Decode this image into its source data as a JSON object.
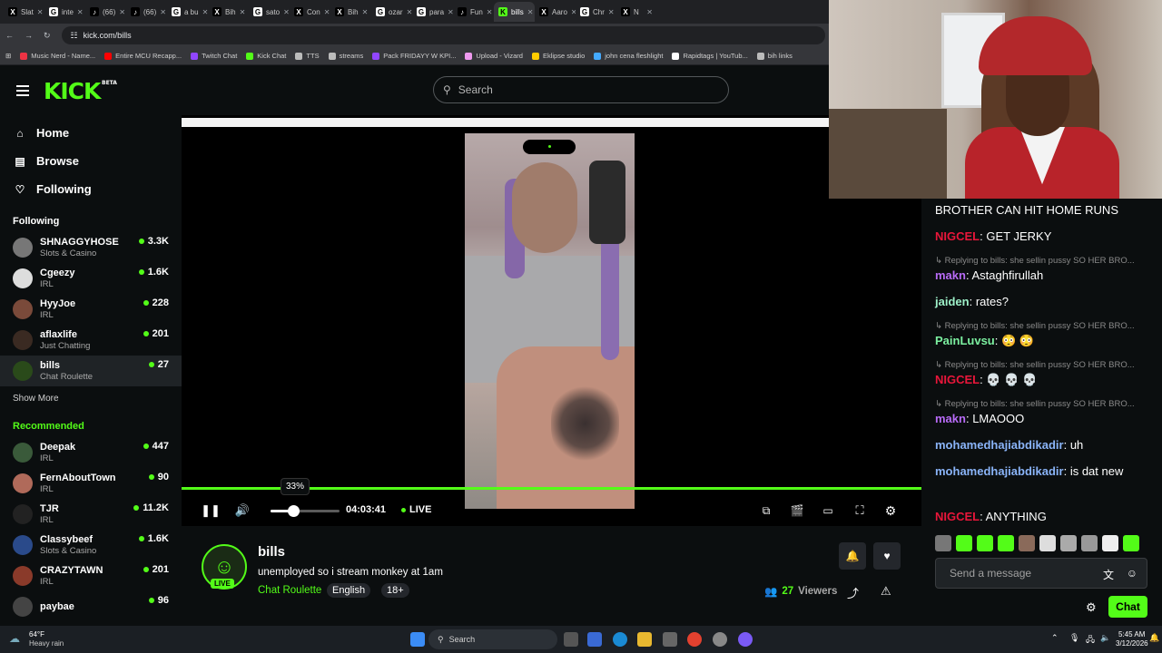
{
  "browser": {
    "tabs": [
      {
        "label": "Slat",
        "fav": "X",
        "color": "#000"
      },
      {
        "label": "inte",
        "fav": "G",
        "color": "#fff"
      },
      {
        "label": "(66)",
        "fav": "♪",
        "color": "#000"
      },
      {
        "label": "(66)",
        "fav": "♪",
        "color": "#000"
      },
      {
        "label": "a bu",
        "fav": "G",
        "color": "#fff"
      },
      {
        "label": "Bih",
        "fav": "X",
        "color": "#000"
      },
      {
        "label": "sato",
        "fav": "G",
        "color": "#fff"
      },
      {
        "label": "Con",
        "fav": "X",
        "color": "#000"
      },
      {
        "label": "Bih",
        "fav": "X",
        "color": "#000"
      },
      {
        "label": "ozar",
        "fav": "G",
        "color": "#fff"
      },
      {
        "label": "para",
        "fav": "G",
        "color": "#fff"
      },
      {
        "label": "Fun",
        "fav": "♪",
        "color": "#000"
      },
      {
        "label": "bills",
        "fav": "K",
        "color": "#53fc18",
        "active": true
      },
      {
        "label": "Aaro",
        "fav": "X",
        "color": "#000"
      },
      {
        "label": "Chr",
        "fav": "G",
        "color": "#fff"
      },
      {
        "label": "N",
        "fav": "X",
        "color": "#000"
      }
    ],
    "url": "kick.com/bills",
    "bookmarks": [
      {
        "label": "Music Nerd - Name...",
        "color": "#e34"
      },
      {
        "label": "Entire MCU Recapp...",
        "color": "#f00"
      },
      {
        "label": "Twitch Chat",
        "color": "#9146ff"
      },
      {
        "label": "Kick Chat",
        "color": "#53fc18"
      },
      {
        "label": "TTS",
        "color": "#bbb"
      },
      {
        "label": "streams",
        "color": "#bbb"
      },
      {
        "label": "Pack FRIDAYY W KPI...",
        "color": "#9146ff"
      },
      {
        "label": "Upload - Vizard",
        "color": "#e9e"
      },
      {
        "label": "Eklipse studio",
        "color": "#fc0"
      },
      {
        "label": "john cena fleshlight",
        "color": "#4af"
      },
      {
        "label": "Rapidtags | YouTub...",
        "color": "#fff"
      },
      {
        "label": "bih links",
        "color": "#bbb"
      }
    ]
  },
  "header": {
    "logo": "KICK",
    "beta": "BETA",
    "search_placeholder": "Search"
  },
  "sidebar": {
    "nav": [
      {
        "label": "Home",
        "icon": "⌂"
      },
      {
        "label": "Browse",
        "icon": "▤"
      },
      {
        "label": "Following",
        "icon": "♡"
      }
    ],
    "following_title": "Following",
    "following": [
      {
        "name": "SHNAGGYHOSE",
        "cat": "Slots & Casino",
        "viewers": "3.3K",
        "color": "#777"
      },
      {
        "name": "Cgeezy",
        "cat": "IRL",
        "viewers": "1.6K",
        "color": "#ddd"
      },
      {
        "name": "HyyJoe",
        "cat": "IRL",
        "viewers": "228",
        "color": "#7a4a3a"
      },
      {
        "name": "aflaxlife",
        "cat": "Just Chatting",
        "viewers": "201",
        "color": "#3a2a22"
      },
      {
        "name": "bills",
        "cat": "Chat Roulette",
        "viewers": "27",
        "color": "#2a4a1a",
        "selected": true
      }
    ],
    "show_more": "Show More",
    "recommended_title": "Recommended",
    "recommended": [
      {
        "name": "Deepak",
        "cat": "IRL",
        "viewers": "447",
        "color": "#3a5a3a"
      },
      {
        "name": "FernAboutTown",
        "cat": "IRL",
        "viewers": "90",
        "color": "#b06a5a"
      },
      {
        "name": "TJR",
        "cat": "IRL",
        "viewers": "11.2K",
        "color": "#222"
      },
      {
        "name": "Classybeef",
        "cat": "Slots & Casino",
        "viewers": "1.6K",
        "color": "#2a4a8a"
      },
      {
        "name": "CRAZYTAWN",
        "cat": "IRL",
        "viewers": "201",
        "color": "#8a3a2a"
      },
      {
        "name": "paybae",
        "cat": "",
        "viewers": "96",
        "color": "#444"
      }
    ]
  },
  "player": {
    "volume_tooltip": "33%",
    "volume_level": 0.33,
    "timecode": "04:03:41",
    "live_label": "LIVE"
  },
  "stream": {
    "name": "bills",
    "live_badge": "LIVE",
    "title": "unemployed so i stream monkey at 1am",
    "category": "Chat Roulette",
    "tags": [
      "English",
      "18+"
    ],
    "viewers_count": "27",
    "viewers_label": "Viewers"
  },
  "chat": {
    "messages": [
      {
        "type": "msg",
        "user": "",
        "color": "#fff",
        "text": "BROTHER CAN HIT HOME RUNS"
      },
      {
        "type": "msg",
        "user": "NIGCEL",
        "color": "#e9163a",
        "text": "GET JERKY"
      },
      {
        "type": "reply",
        "text": "↳ Replying to bills: she sellin pussy SO HER BRO..."
      },
      {
        "type": "msg",
        "user": "makn",
        "color": "#b86bf7",
        "text": "Astaghfirullah"
      },
      {
        "type": "msg",
        "user": "jaiden",
        "color": "#9df0c8",
        "text": "rates?"
      },
      {
        "type": "reply",
        "text": "↳ Replying to bills: she sellin pussy SO HER BRO..."
      },
      {
        "type": "msg",
        "user": "PainLuvsu",
        "color": "#7cf0a0",
        "text": "😳 😳"
      },
      {
        "type": "reply",
        "text": "↳ Replying to bills: she sellin pussy SO HER BRO..."
      },
      {
        "type": "msg",
        "user": "NIGCEL",
        "color": "#e9163a",
        "text": "💀 💀 💀"
      },
      {
        "type": "reply",
        "text": "↳ Replying to bills: she sellin pussy SO HER BRO..."
      },
      {
        "type": "msg",
        "user": "makn",
        "color": "#b86bf7",
        "text": "LMAOOO"
      },
      {
        "type": "msg",
        "user": "mohamedhajiabdikadir",
        "color": "#8ab4f8",
        "text": "uh"
      },
      {
        "type": "msg",
        "user": "mohamedhajiabdikadir",
        "color": "#8ab4f8",
        "text": "is dat new"
      },
      {
        "type": "msg",
        "user": "NIGCEL",
        "color": "#e9163a",
        "text": "ANYTHING"
      }
    ],
    "input_placeholder": "Send a message",
    "chat_button": "Chat"
  },
  "taskbar": {
    "weather_temp": "64°F",
    "weather_desc": "Heavy rain",
    "search_label": "Search",
    "time": "5:45 AM",
    "date": "3/12/2026"
  }
}
